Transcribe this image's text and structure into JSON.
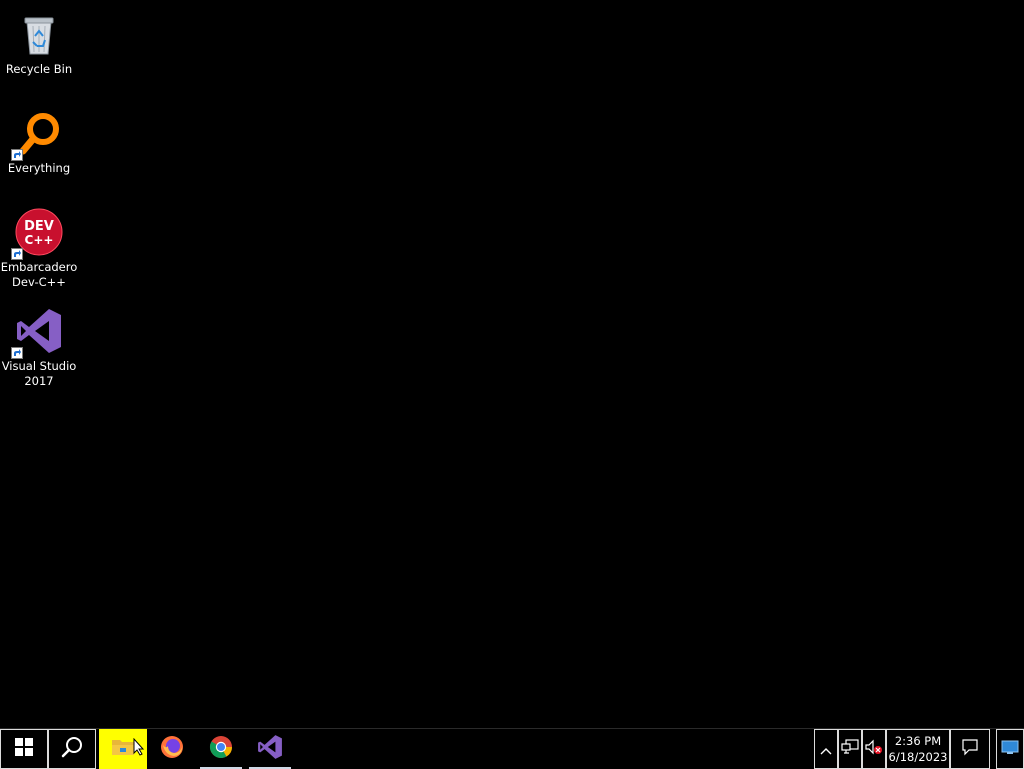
{
  "desktop": {
    "icons": [
      {
        "label": "Recycle Bin"
      },
      {
        "label": "Everything"
      },
      {
        "label": "Embarcadero\nDev-C++",
        "logo_text": "DEV\nC++"
      },
      {
        "label": "Visual Studio\n2017"
      }
    ]
  },
  "taskbar": {
    "start_icon": "windows-logo-icon",
    "search_icon": "search-icon",
    "pinned": [
      {
        "name": "file-explorer",
        "active": false,
        "highlighted": true,
        "highlight_color": "#ffff00"
      },
      {
        "name": "firefox",
        "active": false
      },
      {
        "name": "chrome",
        "active": true
      },
      {
        "name": "visual-studio",
        "active": true
      }
    ],
    "tray": {
      "chevron_icon": "chevron-up-icon",
      "network_icon": "network-icon",
      "volume_icon": "volume-muted-icon",
      "time": "2:36 PM",
      "date": "6/18/2023",
      "notification_icon": "action-center-icon",
      "show_desktop_icon": "show-desktop-icon"
    }
  },
  "colors": {
    "background": "#000000",
    "vs_purple": "#865fc5",
    "everything_orange": "#ff8a00",
    "devcpp_red": "#c8102e"
  }
}
